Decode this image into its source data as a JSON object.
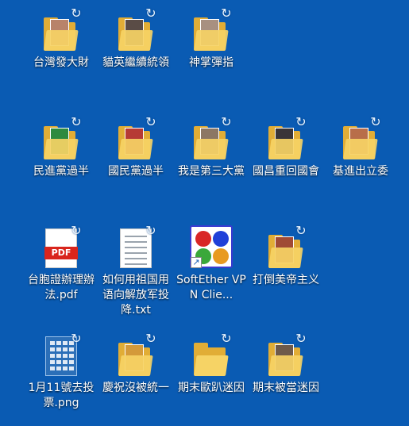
{
  "desktop": {
    "background": "#0a5bb3",
    "icons": [
      {
        "label": "台灣發大財",
        "type": "folder",
        "icon": "folder-icon",
        "photo": "#b8836a"
      },
      {
        "label": "貓英繼續統領",
        "type": "folder",
        "icon": "folder-icon",
        "photo": "#5a4c46"
      },
      {
        "label": "神掌彈指",
        "type": "folder",
        "icon": "folder-icon",
        "photo": "#a89080"
      },
      {
        "label": "民進黨過半",
        "type": "folder",
        "icon": "folder-icon",
        "photo": "#2f8a3f"
      },
      {
        "label": "國民黨過半",
        "type": "folder",
        "icon": "folder-icon",
        "photo": "#b63a35"
      },
      {
        "label": "我是第三大黨",
        "type": "folder",
        "icon": "folder-icon",
        "photo": "#8c7764"
      },
      {
        "label": "國昌重回國會",
        "type": "folder",
        "icon": "folder-icon",
        "photo": "#3a3538"
      },
      {
        "label": "基進出立委",
        "type": "folder",
        "icon": "folder-icon",
        "photo": "#b86e4a"
      },
      {
        "label": "台胞證辦理辦法.pdf",
        "type": "pdf",
        "icon": "pdf-file-icon",
        "badge_text": "PDF"
      },
      {
        "label": "如何用祖国用语向解放军投降.txt",
        "type": "txt",
        "icon": "text-file-icon"
      },
      {
        "label": "SoftEther VPN Clie...",
        "type": "vpn",
        "icon": "softether-vpn-icon"
      },
      {
        "label": "打倒美帝主义",
        "type": "folder",
        "icon": "folder-icon",
        "photo": "#a04a35"
      },
      {
        "label": "1月11號去投票.png",
        "type": "png",
        "icon": "image-file-icon"
      },
      {
        "label": "慶祝沒被統一",
        "type": "folder",
        "icon": "folder-icon",
        "photo": "#d49a3a"
      },
      {
        "label": "期末歐趴迷因",
        "type": "folder",
        "icon": "folder-icon",
        "photo": ""
      },
      {
        "label": "期末被當迷因",
        "type": "folder",
        "icon": "folder-icon",
        "photo": "#6e5a4a"
      }
    ]
  }
}
